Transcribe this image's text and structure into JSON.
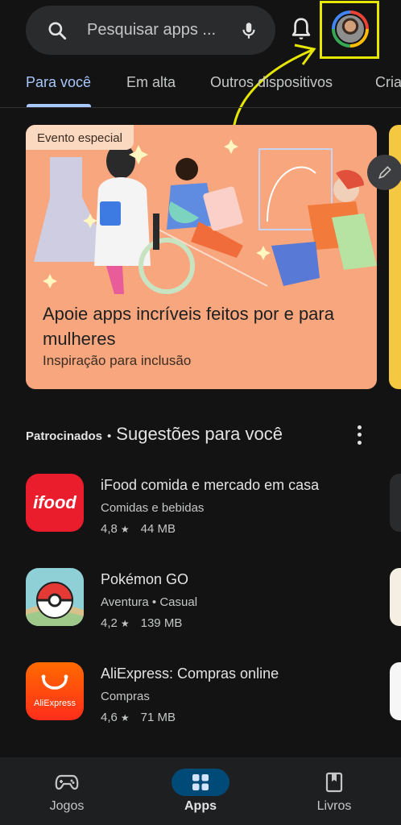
{
  "search": {
    "placeholder": "Pesquisar apps ..."
  },
  "tabs": [
    {
      "label": "Para você",
      "active": true
    },
    {
      "label": "Em alta"
    },
    {
      "label": "Outros dispositivos"
    },
    {
      "label": "Cria"
    }
  ],
  "banner": {
    "chip": "Evento especial",
    "title": "Apoie apps incríveis feitos por e para mulheres",
    "subtitle": "Inspiração para inclusão"
  },
  "section": {
    "sponsored": "Patrocinados",
    "separator": "•",
    "title": "Sugestões para você"
  },
  "apps": [
    {
      "name": "iFood comida e mercado em casa",
      "category": "Comidas e bebidas",
      "rating": "4,8",
      "size": "44 MB",
      "icon": "ifood-icon"
    },
    {
      "name": "Pokémon GO",
      "category": "Aventura • Casual",
      "rating": "4,2",
      "size": "139 MB",
      "icon": "pokemon-go-icon"
    },
    {
      "name": "AliExpress: Compras online",
      "category": "Compras",
      "rating": "4,6",
      "size": "71 MB",
      "icon": "aliexpress-icon"
    }
  ],
  "icon_text": {
    "ifood": "ifood",
    "aliexpress": "AliExpress"
  },
  "bottom_nav": [
    {
      "label": "Jogos",
      "icon": "gamepad-icon"
    },
    {
      "label": "Apps",
      "icon": "apps-grid-icon",
      "active": true
    },
    {
      "label": "Livros",
      "icon": "book-icon"
    }
  ],
  "colors": {
    "background": "#131314",
    "accent": "#a8c7fa",
    "highlight_box": "#e6e600",
    "banner": "#f7a67e",
    "ifood_red": "#ea1d2c",
    "aliexpress_orange": "#ff4a1c"
  }
}
